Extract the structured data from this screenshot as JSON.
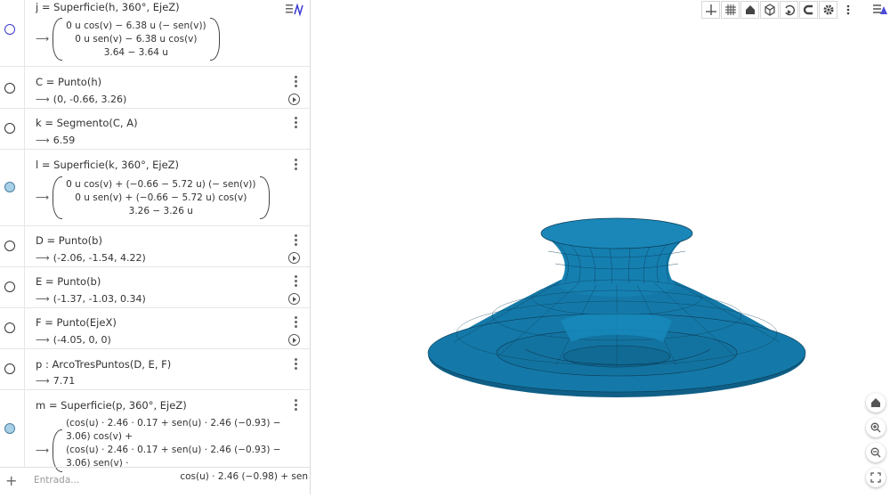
{
  "algebra": {
    "rows": [
      {
        "id": "j",
        "definition": "j = Superficie(h, 360°, EjeZ)",
        "matrix": [
          "0 u  cos(v) − 6.38 u (− sen(v))",
          "0 u  sen(v) − 6.38 u  cos(v)",
          "3.64 − 3.64 u"
        ],
        "visible": "outline-blue"
      },
      {
        "id": "C",
        "definition": "C = Punto(h)",
        "value": "(0, -0.66, 3.26)",
        "visible": "off",
        "play": true
      },
      {
        "id": "k",
        "definition": "k = Segmento(C, A)",
        "value": "6.59",
        "visible": "off"
      },
      {
        "id": "l",
        "definition": "l = Superficie(k, 360°, EjeZ)",
        "matrix": [
          "0 u  cos(v) + (−0.66 − 5.72 u) (− sen(v))",
          "0 u  sen(v) + (−0.66 − 5.72 u)  cos(v)",
          "3.26 − 3.26 u"
        ],
        "visible": "on"
      },
      {
        "id": "D",
        "definition": "D = Punto(b)",
        "value": "(-2.06, -1.54, 4.22)",
        "visible": "off",
        "play": true
      },
      {
        "id": "E",
        "definition": "E = Punto(b)",
        "value": "(-1.37, -1.03, 0.34)",
        "visible": "off",
        "play": true
      },
      {
        "id": "F",
        "definition": "F = Punto(EjeX)",
        "value": "(-4.05, 0, 0)",
        "visible": "off",
        "play": true
      },
      {
        "id": "p",
        "definition": "p : ArcoTresPuntos(D, E, F)",
        "value": "7.71",
        "visible": "off"
      },
      {
        "id": "m",
        "definition": "m = Superficie(p, 360°, EjeZ)",
        "matrix": [
          "(cos(u) · 2.46 · 0.17 + sen(u) · 2.46 (−0.93) − 3.06)  cos(v) +",
          "(cos(u) · 2.46 · 0.17 + sen(u) · 2.46 (−0.93) − 3.06)  sen(v) ·",
          "cos(u) · 2.46 (−0.98) + sen"
        ],
        "visible": "on"
      }
    ],
    "input_placeholder": "Entrada..."
  },
  "toolbar": {
    "buttons": [
      "axes-icon",
      "grid-icon",
      "home-icon",
      "cube-view-icon",
      "rotate-icon",
      "projection-icon",
      "settings-icon",
      "more-icon"
    ]
  },
  "side_buttons": [
    "home-icon",
    "zoom-in-icon",
    "zoom-out-icon",
    "fullscreen-icon"
  ],
  "colors": {
    "surface": "#1479a8",
    "surface_dark": "#0f5f86",
    "mesh": "#0b3b55",
    "marble_on": "#a8d1e8"
  }
}
